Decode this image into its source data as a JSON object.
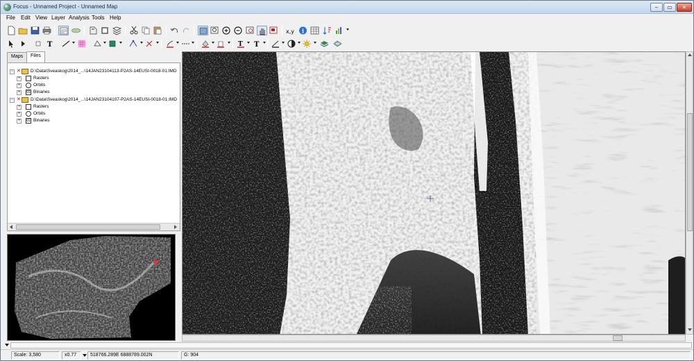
{
  "window": {
    "title": "Focus - Unnamed Project - Unnamed Map",
    "controls": {
      "minimize": "–",
      "maximize": "▭",
      "close": "✕"
    }
  },
  "menu": [
    "File",
    "Edit",
    "View",
    "Layer",
    "Analysis",
    "Tools",
    "Help"
  ],
  "toolbar1": {
    "icons": [
      "new-file-icon",
      "open-folder-icon",
      "save-icon",
      "print-icon",
      "project-icon",
      "layers-icon",
      "undo-history-icon",
      "stop-icon",
      "stack-icon",
      "cut-icon",
      "copy-icon",
      "paste-icon",
      "undo-icon",
      "redo-icon",
      "zoom-to-fit-icon",
      "zoom-box-icon",
      "zoom-in-icon",
      "zoom-out-icon",
      "zoom-extent-icon",
      "pan-hand-icon",
      "zoom-selection-icon",
      "coordinates-icon",
      "info-icon",
      "table-icon",
      "sort-icon",
      "chart-icon"
    ]
  },
  "toolbar2": {
    "icons": [
      "pointer-icon",
      "next-icon",
      "node-edit-icon",
      "text-tool-icon",
      "line-style-icon",
      "grid-icon",
      "shape-edit-icon",
      "fill-icon",
      "vertex-icon",
      "tools-icon",
      "pen-icon",
      "line-dash-icon",
      "fill-color-icon",
      "paint-bucket-icon",
      "font-color-icon",
      "text-size-icon",
      "line-color-icon",
      "contrast-icon",
      "brightness-icon",
      "layer-stack-icon",
      "raster-icon"
    ],
    "coord_label": "x,y"
  },
  "left_panel": {
    "tabs": [
      "Maps",
      "Files"
    ],
    "active_tab": "Files",
    "tree": [
      {
        "path": "D:\\Data\\Sveaskog\\2014_...\\14JAN23104113-P2AS-14EUSI-0018-01.IMD",
        "children": [
          "Rasters",
          "Orbits",
          "Binaries"
        ]
      },
      {
        "path": "D:\\Data\\Sveaskog\\2014_...\\14JAN23104107-P2AS-14EUSI-0018-01.IMD",
        "children": [
          "Rasters",
          "Orbits",
          "Binaries"
        ]
      }
    ],
    "binary_icon_text": "01"
  },
  "map": {
    "cursor": "+"
  },
  "status": {
    "scale": "Scale: 3,580",
    "zoom": "x0.77",
    "coordinates": "518766.289E 6888789.002N",
    "value": "G:   904"
  },
  "colors": {
    "title_bar": "#c4d6ec",
    "close_button": "#c3412b",
    "panel_bg": "#f0f0f0",
    "marker": "#ff2a2a"
  }
}
